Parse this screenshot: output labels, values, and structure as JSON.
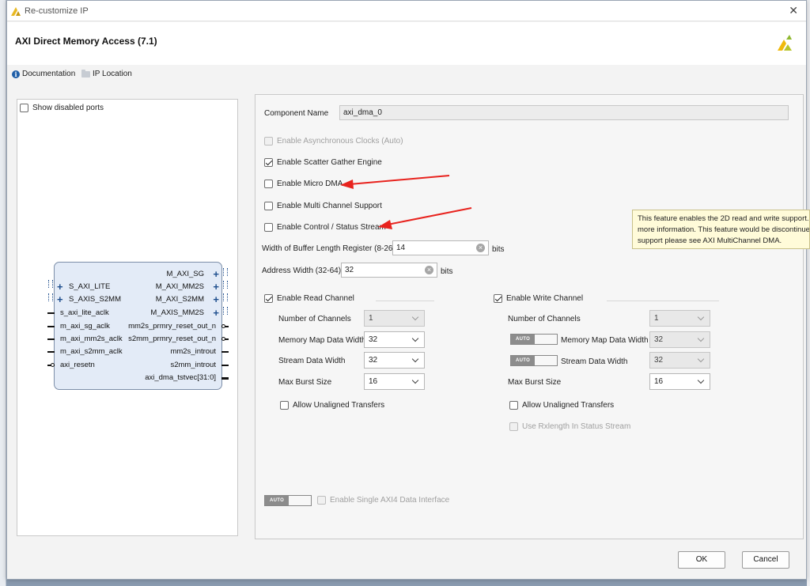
{
  "window": {
    "title": "Re-customize IP",
    "close_glyph": "✕"
  },
  "header": {
    "ip_title": "AXI Direct Memory Access (7.1)"
  },
  "links": {
    "documentation": "Documentation",
    "ip_location": "IP Location"
  },
  "left_panel": {
    "show_disabled_ports": "Show disabled ports",
    "show_disabled_ports_checked": false,
    "block": {
      "left_ports": [
        "S_AXI_LITE",
        "S_AXIS_S2MM",
        "s_axi_lite_aclk",
        "m_axi_sg_aclk",
        "m_axi_mm2s_aclk",
        "m_axi_s2mm_aclk",
        "axi_resetn"
      ],
      "right_ports": [
        "M_AXI_SG",
        "M_AXI_MM2S",
        "M_AXI_S2MM",
        "M_AXIS_MM2S",
        "mm2s_prmry_reset_out_n",
        "s2mm_prmry_reset_out_n",
        "mm2s_introut",
        "s2mm_introut",
        "axi_dma_tstvec[31:0]"
      ]
    }
  },
  "config": {
    "component_name_label": "Component Name",
    "component_name_value": "axi_dma_0",
    "enable_async_clocks": "Enable Asynchronous Clocks (Auto)",
    "enable_scatter_gather": "Enable Scatter Gather Engine",
    "enable_micro_dma": "Enable Micro DMA",
    "enable_multi_channel": "Enable Multi Channel Support",
    "enable_control_status": "Enable Control / Status Stream",
    "buffer_length_label": "Width of Buffer Length Register (8-26)",
    "buffer_length_value": "14",
    "buffer_length_unit": "bits",
    "address_width_label": "Address Width (32-64)",
    "address_width_value": "32",
    "address_width_unit": "bits",
    "read_channel": {
      "title": "Enable Read Channel",
      "num_channels_label": "Number of Channels",
      "num_channels_value": "1",
      "mm_data_width_label": "Memory Map Data Width",
      "mm_data_width_value": "32",
      "stream_data_width_label": "Stream Data Width",
      "stream_data_width_value": "32",
      "max_burst_label": "Max Burst Size",
      "max_burst_value": "16",
      "unaligned_label": "Allow Unaligned Transfers"
    },
    "write_channel": {
      "title": "Enable Write Channel",
      "num_channels_label": "Number of Channels",
      "num_channels_value": "1",
      "mm_data_width_label": "Memory Map Data Width",
      "mm_data_width_value": "32",
      "stream_data_width_label": "Stream Data Width",
      "stream_data_width_value": "32",
      "max_burst_label": "Max Burst Size",
      "max_burst_value": "16",
      "unaligned_label": "Allow Unaligned Transfers",
      "rxlength_label": "Use Rxlength In Status Stream"
    },
    "auto_label": "AUTO",
    "single_axi4": "Enable Single AXI4 Data Interface"
  },
  "tooltip": {
    "line1": "This feature enables the 2D read and write support.",
    "line2": "more information. This feature would be discontinue",
    "line3": "support please see AXI MultiChannel DMA."
  },
  "buttons": {
    "ok": "OK",
    "cancel": "Cancel"
  },
  "colors": {
    "annotation_arrow": "#e8231e",
    "block_fill": "#e3ebf7",
    "accent_blue": "#1f4f8e"
  }
}
